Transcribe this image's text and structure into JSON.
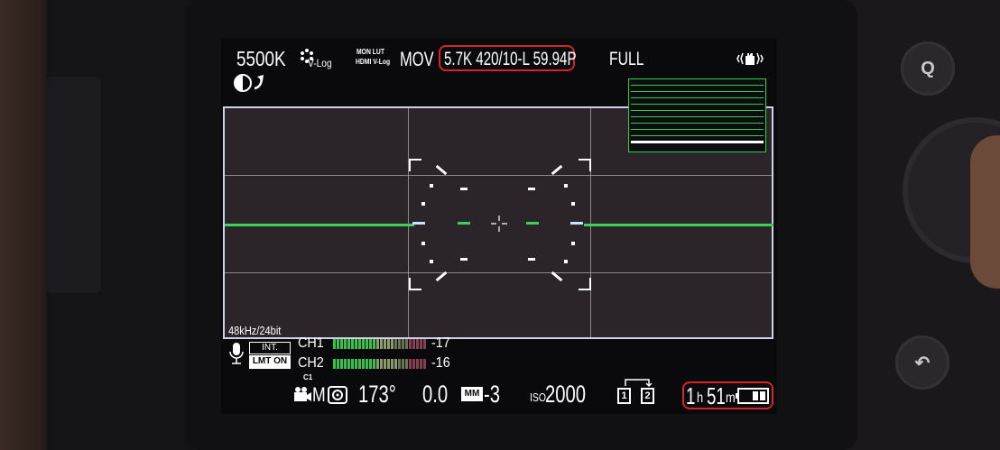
{
  "top_bar": {
    "white_balance": "5500K",
    "photo_style": "V-Log",
    "mon_lut_line1": "MON LUT",
    "mon_lut_line2": "HDMI V-Log",
    "file_format": "MOV",
    "rec_quality": "5.7K  420/10-L 59.94P",
    "sensor_mode": "FULL",
    "stabilizer_icon": "hand-stabilizer-icon",
    "highlight_color": "#d1262d"
  },
  "audio": {
    "sample_rate": "48kHz/24bit",
    "input_label": "INT.",
    "limiter_label": "LMT ON",
    "channels": [
      {
        "name": "CH1",
        "level": "-17",
        "fill": 0.63
      },
      {
        "name": "CH2",
        "level": "-16",
        "fill": 0.66
      }
    ],
    "meter_colors": {
      "low": "#34c24a",
      "mid": "#8d9a6a",
      "high": "#b0516a"
    }
  },
  "bottom_bar": {
    "custom_mode": "C1",
    "exposure_mode": "M",
    "shutter_angle": "173°",
    "exposure_comp": "0.0",
    "mm_badge": "MM",
    "mm_value": "-3",
    "iso_prefix": "ISO",
    "iso_value": "2000",
    "card_slot_1": "1",
    "card_slot_2": "2",
    "remaining_hours": "1",
    "remaining_h_unit": "h",
    "remaining_minutes": "51",
    "remaining_m_unit": "m"
  },
  "buttons": {
    "q": "Q",
    "back": "↶"
  },
  "level_gauge": {
    "roll_deg": 0,
    "color": "#3bd15a"
  }
}
